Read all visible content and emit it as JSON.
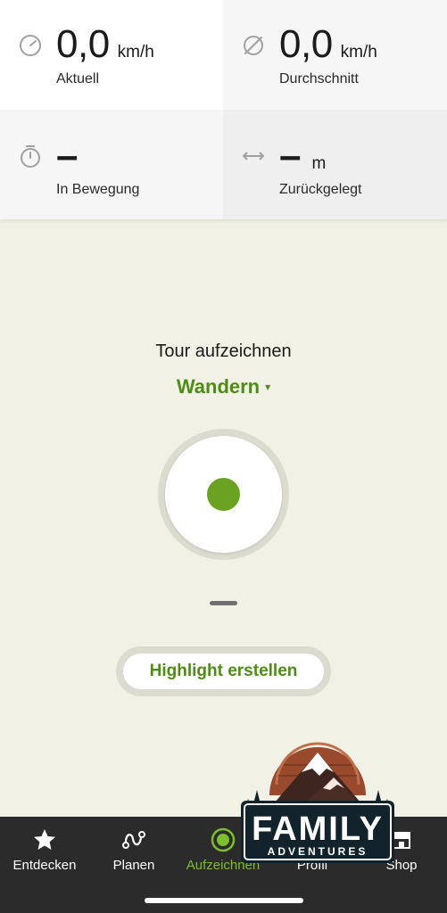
{
  "stats": {
    "current": {
      "value": "0,0",
      "unit": "km/h",
      "label": "Aktuell",
      "icon": "speedometer-icon"
    },
    "average": {
      "value": "0,0",
      "unit": "km/h",
      "label": "Durchschnitt",
      "icon": "average-icon"
    },
    "moving": {
      "value": "–",
      "label": "In Bewegung",
      "icon": "stopwatch-icon"
    },
    "distance": {
      "value": "–",
      "unit": "m",
      "label": "Zurückgelegt",
      "icon": "distance-arrows-icon"
    }
  },
  "record": {
    "title": "Tour aufzeichnen",
    "sport": "Wandern",
    "caret": "▾",
    "highlight_button": "Highlight erstellen"
  },
  "nav": {
    "items": [
      {
        "label": "Entdecken",
        "icon": "star-icon"
      },
      {
        "label": "Planen",
        "icon": "route-icon"
      },
      {
        "label": "Aufzeichnen",
        "icon": "record-icon",
        "active": true
      },
      {
        "label": "Profil",
        "icon": "profile-icon"
      },
      {
        "label": "Shop",
        "icon": "shop-icon"
      }
    ]
  },
  "logo": {
    "line1": "FAMILY",
    "line2": "ADVENTURES"
  },
  "colors": {
    "accent_green": "#4f8c16",
    "record_dot": "#6aa222",
    "background": "#f2f1e6",
    "nav_background": "#2b2b2b"
  }
}
